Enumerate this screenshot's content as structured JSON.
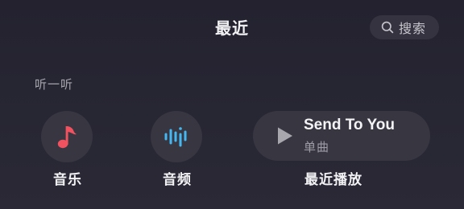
{
  "header": {
    "title": "最近",
    "search": {
      "icon": "search-icon",
      "label": "搜索"
    }
  },
  "section": {
    "title": "听一听"
  },
  "shortcuts": [
    {
      "id": "music",
      "icon": "music-note-icon",
      "label": "音乐",
      "color": "#f0525f"
    },
    {
      "id": "audio",
      "icon": "audio-wave-icon",
      "label": "音频",
      "color": "#44b8f2"
    }
  ],
  "recent": {
    "label": "最近播放",
    "icon": "play-icon",
    "song_title": "Send To You",
    "song_type": "单曲"
  }
}
